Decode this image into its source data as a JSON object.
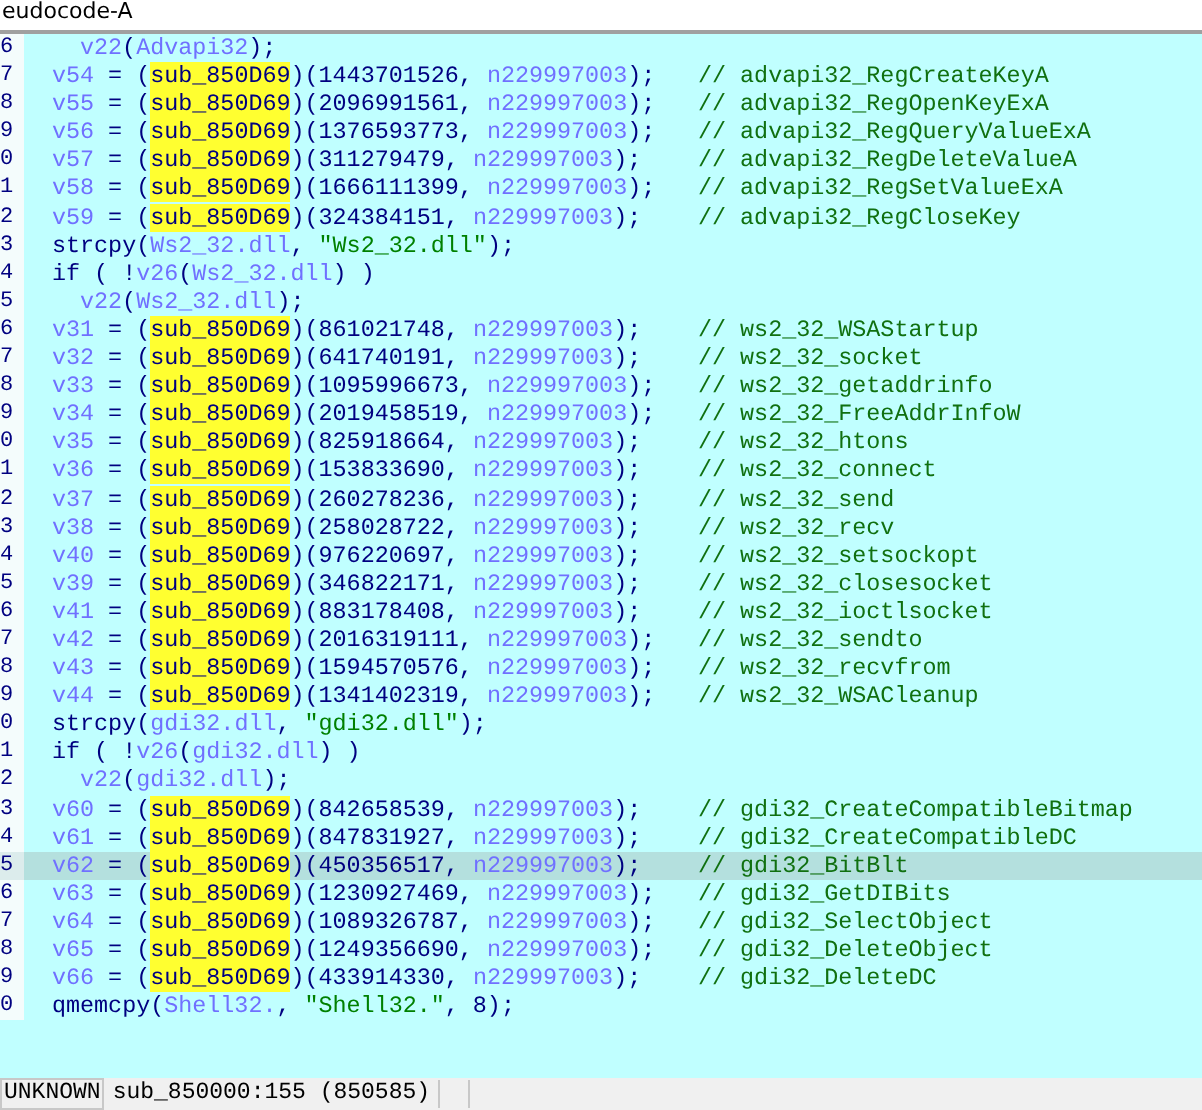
{
  "tab": {
    "title": "eudocode-A"
  },
  "lines": [
    {
      "no": "6",
      "kind": "nested",
      "selected": false,
      "tokens": [
        {
          "kind": "var",
          "t": "v22"
        },
        {
          "kind": "plain",
          "t": "("
        },
        {
          "kind": "var",
          "t": "Advapi32"
        },
        {
          "kind": "plain",
          "t": ");"
        }
      ]
    },
    {
      "no": "7",
      "kind": "statement",
      "selected": false,
      "tokens": [
        {
          "kind": "var",
          "t": "v54"
        },
        {
          "kind": "plain",
          "t": " = ("
        },
        {
          "kind": "match",
          "t": "sub_850D69"
        },
        {
          "kind": "plain",
          "t": ")(1443701526, "
        },
        {
          "kind": "var",
          "t": "n229997003"
        },
        {
          "kind": "plain",
          "t": ");"
        }
      ],
      "comment": "// advapi32_RegCreateKeyA"
    },
    {
      "no": "8",
      "kind": "statement",
      "selected": false,
      "tokens": [
        {
          "kind": "var",
          "t": "v55"
        },
        {
          "kind": "plain",
          "t": " = ("
        },
        {
          "kind": "match",
          "t": "sub_850D69"
        },
        {
          "kind": "plain",
          "t": ")(2096991561, "
        },
        {
          "kind": "var",
          "t": "n229997003"
        },
        {
          "kind": "plain",
          "t": ");"
        }
      ],
      "comment": "// advapi32_RegOpenKeyExA"
    },
    {
      "no": "9",
      "kind": "statement",
      "selected": false,
      "tokens": [
        {
          "kind": "var",
          "t": "v56"
        },
        {
          "kind": "plain",
          "t": " = ("
        },
        {
          "kind": "match",
          "t": "sub_850D69"
        },
        {
          "kind": "plain",
          "t": ")(1376593773, "
        },
        {
          "kind": "var",
          "t": "n229997003"
        },
        {
          "kind": "plain",
          "t": ");"
        }
      ],
      "comment": "// advapi32_RegQueryValueExA"
    },
    {
      "no": "0",
      "kind": "statement",
      "selected": false,
      "tokens": [
        {
          "kind": "var",
          "t": "v57"
        },
        {
          "kind": "plain",
          "t": " = ("
        },
        {
          "kind": "match",
          "t": "sub_850D69"
        },
        {
          "kind": "plain",
          "t": ")(311279479, "
        },
        {
          "kind": "var",
          "t": "n229997003"
        },
        {
          "kind": "plain",
          "t": ");"
        }
      ],
      "comment": "// advapi32_RegDeleteValueA"
    },
    {
      "no": "1",
      "kind": "statement",
      "selected": false,
      "tokens": [
        {
          "kind": "var",
          "t": "v58"
        },
        {
          "kind": "plain",
          "t": " = ("
        },
        {
          "kind": "match",
          "t": "sub_850D69"
        },
        {
          "kind": "plain",
          "t": ")(1666111399, "
        },
        {
          "kind": "var",
          "t": "n229997003"
        },
        {
          "kind": "plain",
          "t": ");"
        }
      ],
      "comment": "// advapi32_RegSetValueExA"
    },
    {
      "no": "2",
      "kind": "statement",
      "selected": false,
      "tokens": [
        {
          "kind": "var",
          "t": "v59"
        },
        {
          "kind": "plain",
          "t": " = ("
        },
        {
          "kind": "match",
          "t": "sub_850D69"
        },
        {
          "kind": "plain",
          "t": ")(324384151, "
        },
        {
          "kind": "var",
          "t": "n229997003"
        },
        {
          "kind": "plain",
          "t": ");"
        }
      ],
      "comment": "// advapi32_RegCloseKey"
    },
    {
      "no": "3",
      "kind": "statement",
      "selected": false,
      "tokens": [
        {
          "kind": "plain",
          "t": "strcpy("
        },
        {
          "kind": "var",
          "t": "Ws2_32.dll"
        },
        {
          "kind": "plain",
          "t": ", "
        },
        {
          "kind": "string",
          "t": "\"Ws2_32.dll\""
        },
        {
          "kind": "plain",
          "t": ");"
        }
      ]
    },
    {
      "no": "4",
      "kind": "statement",
      "selected": false,
      "tokens": [
        {
          "kind": "plain",
          "t": "if ( !"
        },
        {
          "kind": "var",
          "t": "v26"
        },
        {
          "kind": "plain",
          "t": "("
        },
        {
          "kind": "var",
          "t": "Ws2_32.dll"
        },
        {
          "kind": "plain",
          "t": ") )"
        }
      ]
    },
    {
      "no": "5",
      "kind": "nested",
      "selected": false,
      "tokens": [
        {
          "kind": "var",
          "t": "v22"
        },
        {
          "kind": "plain",
          "t": "("
        },
        {
          "kind": "var",
          "t": "Ws2_32.dll"
        },
        {
          "kind": "plain",
          "t": ");"
        }
      ]
    },
    {
      "no": "6",
      "kind": "statement",
      "selected": false,
      "tokens": [
        {
          "kind": "var",
          "t": "v31"
        },
        {
          "kind": "plain",
          "t": " = ("
        },
        {
          "kind": "match",
          "t": "sub_850D69"
        },
        {
          "kind": "plain",
          "t": ")(861021748, "
        },
        {
          "kind": "var",
          "t": "n229997003"
        },
        {
          "kind": "plain",
          "t": ");"
        }
      ],
      "comment": "// ws2_32_WSAStartup"
    },
    {
      "no": "7",
      "kind": "statement",
      "selected": false,
      "tokens": [
        {
          "kind": "var",
          "t": "v32"
        },
        {
          "kind": "plain",
          "t": " = ("
        },
        {
          "kind": "match",
          "t": "sub_850D69"
        },
        {
          "kind": "plain",
          "t": ")(641740191, "
        },
        {
          "kind": "var",
          "t": "n229997003"
        },
        {
          "kind": "plain",
          "t": ");"
        }
      ],
      "comment": "// ws2_32_socket"
    },
    {
      "no": "8",
      "kind": "statement",
      "selected": false,
      "tokens": [
        {
          "kind": "var",
          "t": "v33"
        },
        {
          "kind": "plain",
          "t": " = ("
        },
        {
          "kind": "match",
          "t": "sub_850D69"
        },
        {
          "kind": "plain",
          "t": ")(1095996673, "
        },
        {
          "kind": "var",
          "t": "n229997003"
        },
        {
          "kind": "plain",
          "t": ");"
        }
      ],
      "comment": "// ws2_32_getaddrinfo"
    },
    {
      "no": "9",
      "kind": "statement",
      "selected": false,
      "tokens": [
        {
          "kind": "var",
          "t": "v34"
        },
        {
          "kind": "plain",
          "t": " = ("
        },
        {
          "kind": "match",
          "t": "sub_850D69"
        },
        {
          "kind": "plain",
          "t": ")(2019458519, "
        },
        {
          "kind": "var",
          "t": "n229997003"
        },
        {
          "kind": "plain",
          "t": ");"
        }
      ],
      "comment": "// ws2_32_FreeAddrInfoW"
    },
    {
      "no": "0",
      "kind": "statement",
      "selected": false,
      "tokens": [
        {
          "kind": "var",
          "t": "v35"
        },
        {
          "kind": "plain",
          "t": " = ("
        },
        {
          "kind": "match",
          "t": "sub_850D69"
        },
        {
          "kind": "plain",
          "t": ")(825918664, "
        },
        {
          "kind": "var",
          "t": "n229997003"
        },
        {
          "kind": "plain",
          "t": ");"
        }
      ],
      "comment": "// ws2_32_htons"
    },
    {
      "no": "1",
      "kind": "statement",
      "selected": false,
      "tokens": [
        {
          "kind": "var",
          "t": "v36"
        },
        {
          "kind": "plain",
          "t": " = ("
        },
        {
          "kind": "match",
          "t": "sub_850D69"
        },
        {
          "kind": "plain",
          "t": ")(153833690, "
        },
        {
          "kind": "var",
          "t": "n229997003"
        },
        {
          "kind": "plain",
          "t": ");"
        }
      ],
      "comment": "// ws2_32_connect"
    },
    {
      "no": "2",
      "kind": "statement",
      "selected": false,
      "tokens": [
        {
          "kind": "var",
          "t": "v37"
        },
        {
          "kind": "plain",
          "t": " = ("
        },
        {
          "kind": "match",
          "t": "sub_850D69"
        },
        {
          "kind": "plain",
          "t": ")(260278236, "
        },
        {
          "kind": "var",
          "t": "n229997003"
        },
        {
          "kind": "plain",
          "t": ");"
        }
      ],
      "comment": "// ws2_32_send"
    },
    {
      "no": "3",
      "kind": "statement",
      "selected": false,
      "tokens": [
        {
          "kind": "var",
          "t": "v38"
        },
        {
          "kind": "plain",
          "t": " = ("
        },
        {
          "kind": "match",
          "t": "sub_850D69"
        },
        {
          "kind": "plain",
          "t": ")(258028722, "
        },
        {
          "kind": "var",
          "t": "n229997003"
        },
        {
          "kind": "plain",
          "t": ");"
        }
      ],
      "comment": "// ws2_32_recv"
    },
    {
      "no": "4",
      "kind": "statement",
      "selected": false,
      "tokens": [
        {
          "kind": "var",
          "t": "v40"
        },
        {
          "kind": "plain",
          "t": " = ("
        },
        {
          "kind": "match",
          "t": "sub_850D69"
        },
        {
          "kind": "plain",
          "t": ")(976220697, "
        },
        {
          "kind": "var",
          "t": "n229997003"
        },
        {
          "kind": "plain",
          "t": ");"
        }
      ],
      "comment": "// ws2_32_setsockopt"
    },
    {
      "no": "5",
      "kind": "statement",
      "selected": false,
      "tokens": [
        {
          "kind": "var",
          "t": "v39"
        },
        {
          "kind": "plain",
          "t": " = ("
        },
        {
          "kind": "match",
          "t": "sub_850D69"
        },
        {
          "kind": "plain",
          "t": ")(346822171, "
        },
        {
          "kind": "var",
          "t": "n229997003"
        },
        {
          "kind": "plain",
          "t": ");"
        }
      ],
      "comment": "// ws2_32_closesocket"
    },
    {
      "no": "6",
      "kind": "statement",
      "selected": false,
      "tokens": [
        {
          "kind": "var",
          "t": "v41"
        },
        {
          "kind": "plain",
          "t": " = ("
        },
        {
          "kind": "match",
          "t": "sub_850D69"
        },
        {
          "kind": "plain",
          "t": ")(883178408, "
        },
        {
          "kind": "var",
          "t": "n229997003"
        },
        {
          "kind": "plain",
          "t": ");"
        }
      ],
      "comment": "// ws2_32_ioctlsocket"
    },
    {
      "no": "7",
      "kind": "statement",
      "selected": false,
      "tokens": [
        {
          "kind": "var",
          "t": "v42"
        },
        {
          "kind": "plain",
          "t": " = ("
        },
        {
          "kind": "match",
          "t": "sub_850D69"
        },
        {
          "kind": "plain",
          "t": ")(2016319111, "
        },
        {
          "kind": "var",
          "t": "n229997003"
        },
        {
          "kind": "plain",
          "t": ");"
        }
      ],
      "comment": "// ws2_32_sendto"
    },
    {
      "no": "8",
      "kind": "statement",
      "selected": false,
      "tokens": [
        {
          "kind": "var",
          "t": "v43"
        },
        {
          "kind": "plain",
          "t": " = ("
        },
        {
          "kind": "match",
          "t": "sub_850D69"
        },
        {
          "kind": "plain",
          "t": ")(1594570576, "
        },
        {
          "kind": "var",
          "t": "n229997003"
        },
        {
          "kind": "plain",
          "t": ");"
        }
      ],
      "comment": "// ws2_32_recvfrom"
    },
    {
      "no": "9",
      "kind": "statement",
      "selected": false,
      "tokens": [
        {
          "kind": "var",
          "t": "v44"
        },
        {
          "kind": "plain",
          "t": " = ("
        },
        {
          "kind": "match",
          "t": "sub_850D69"
        },
        {
          "kind": "plain",
          "t": ")(1341402319, "
        },
        {
          "kind": "var",
          "t": "n229997003"
        },
        {
          "kind": "plain",
          "t": ");"
        }
      ],
      "comment": "// ws2_32_WSACleanup"
    },
    {
      "no": "0",
      "kind": "statement",
      "selected": false,
      "tokens": [
        {
          "kind": "plain",
          "t": "strcpy("
        },
        {
          "kind": "var",
          "t": "gdi32.dll"
        },
        {
          "kind": "plain",
          "t": ", "
        },
        {
          "kind": "string",
          "t": "\"gdi32.dll\""
        },
        {
          "kind": "plain",
          "t": ");"
        }
      ]
    },
    {
      "no": "1",
      "kind": "statement",
      "selected": false,
      "tokens": [
        {
          "kind": "plain",
          "t": "if ( !"
        },
        {
          "kind": "var",
          "t": "v26"
        },
        {
          "kind": "plain",
          "t": "("
        },
        {
          "kind": "var",
          "t": "gdi32.dll"
        },
        {
          "kind": "plain",
          "t": ") )"
        }
      ]
    },
    {
      "no": "2",
      "kind": "nested",
      "selected": false,
      "tokens": [
        {
          "kind": "var",
          "t": "v22"
        },
        {
          "kind": "plain",
          "t": "("
        },
        {
          "kind": "var",
          "t": "gdi32.dll"
        },
        {
          "kind": "plain",
          "t": ");"
        }
      ]
    },
    {
      "no": "3",
      "kind": "statement",
      "selected": false,
      "tokens": [
        {
          "kind": "var",
          "t": "v60"
        },
        {
          "kind": "plain",
          "t": " = ("
        },
        {
          "kind": "match",
          "t": "sub_850D69"
        },
        {
          "kind": "plain",
          "t": ")(842658539, "
        },
        {
          "kind": "var",
          "t": "n229997003"
        },
        {
          "kind": "plain",
          "t": ");"
        }
      ],
      "comment": "// gdi32_CreateCompatibleBitmap"
    },
    {
      "no": "4",
      "kind": "statement",
      "selected": false,
      "tokens": [
        {
          "kind": "var",
          "t": "v61"
        },
        {
          "kind": "plain",
          "t": " = ("
        },
        {
          "kind": "match",
          "t": "sub_850D69"
        },
        {
          "kind": "plain",
          "t": ")(847831927, "
        },
        {
          "kind": "var",
          "t": "n229997003"
        },
        {
          "kind": "plain",
          "t": ");"
        }
      ],
      "comment": "// gdi32_CreateCompatibleDC"
    },
    {
      "no": "5",
      "kind": "statement",
      "selected": true,
      "tokens": [
        {
          "kind": "var",
          "t": "v62"
        },
        {
          "kind": "plain",
          "t": " = ("
        },
        {
          "kind": "match",
          "t": "sub_850D69"
        },
        {
          "kind": "plain",
          "t": ")(450356517, "
        },
        {
          "kind": "var",
          "t": "n229997003"
        },
        {
          "kind": "plain",
          "t": ");"
        }
      ],
      "comment": "// gdi32_BitBlt"
    },
    {
      "no": "6",
      "kind": "statement",
      "selected": false,
      "tokens": [
        {
          "kind": "var",
          "t": "v63"
        },
        {
          "kind": "plain",
          "t": " = ("
        },
        {
          "kind": "match",
          "t": "sub_850D69"
        },
        {
          "kind": "plain",
          "t": ")(1230927469, "
        },
        {
          "kind": "var",
          "t": "n229997003"
        },
        {
          "kind": "plain",
          "t": ");"
        }
      ],
      "comment": "// gdi32_GetDIBits"
    },
    {
      "no": "7",
      "kind": "statement",
      "selected": false,
      "tokens": [
        {
          "kind": "var",
          "t": "v64"
        },
        {
          "kind": "plain",
          "t": " = ("
        },
        {
          "kind": "match",
          "t": "sub_850D69"
        },
        {
          "kind": "plain",
          "t": ")(1089326787, "
        },
        {
          "kind": "var",
          "t": "n229997003"
        },
        {
          "kind": "plain",
          "t": ");"
        }
      ],
      "comment": "// gdi32_SelectObject"
    },
    {
      "no": "8",
      "kind": "statement",
      "selected": false,
      "tokens": [
        {
          "kind": "var",
          "t": "v65"
        },
        {
          "kind": "plain",
          "t": " = ("
        },
        {
          "kind": "match",
          "t": "sub_850D69"
        },
        {
          "kind": "plain",
          "t": ")(1249356690, "
        },
        {
          "kind": "var",
          "t": "n229997003"
        },
        {
          "kind": "plain",
          "t": ");"
        }
      ],
      "comment": "// gdi32_DeleteObject"
    },
    {
      "no": "9",
      "kind": "statement",
      "selected": false,
      "tokens": [
        {
          "kind": "var",
          "t": "v66"
        },
        {
          "kind": "plain",
          "t": " = ("
        },
        {
          "kind": "match",
          "t": "sub_850D69"
        },
        {
          "kind": "plain",
          "t": ")(433914330, "
        },
        {
          "kind": "var",
          "t": "n229997003"
        },
        {
          "kind": "plain",
          "t": ");"
        }
      ],
      "comment": "// gdi32_DeleteDC"
    },
    {
      "no": "0",
      "kind": "statement",
      "selected": false,
      "tokens": [
        {
          "kind": "plain",
          "t": "qmemcpy("
        },
        {
          "kind": "var",
          "t": "Shell32."
        },
        {
          "kind": "plain",
          "t": ", "
        },
        {
          "kind": "string",
          "t": "\"Shell32.\""
        },
        {
          "kind": "plain",
          "t": ", 8);"
        }
      ]
    }
  ],
  "status_bar": {
    "mode": "UNKNOWN",
    "location": "sub_850000:155 (850585)"
  }
}
